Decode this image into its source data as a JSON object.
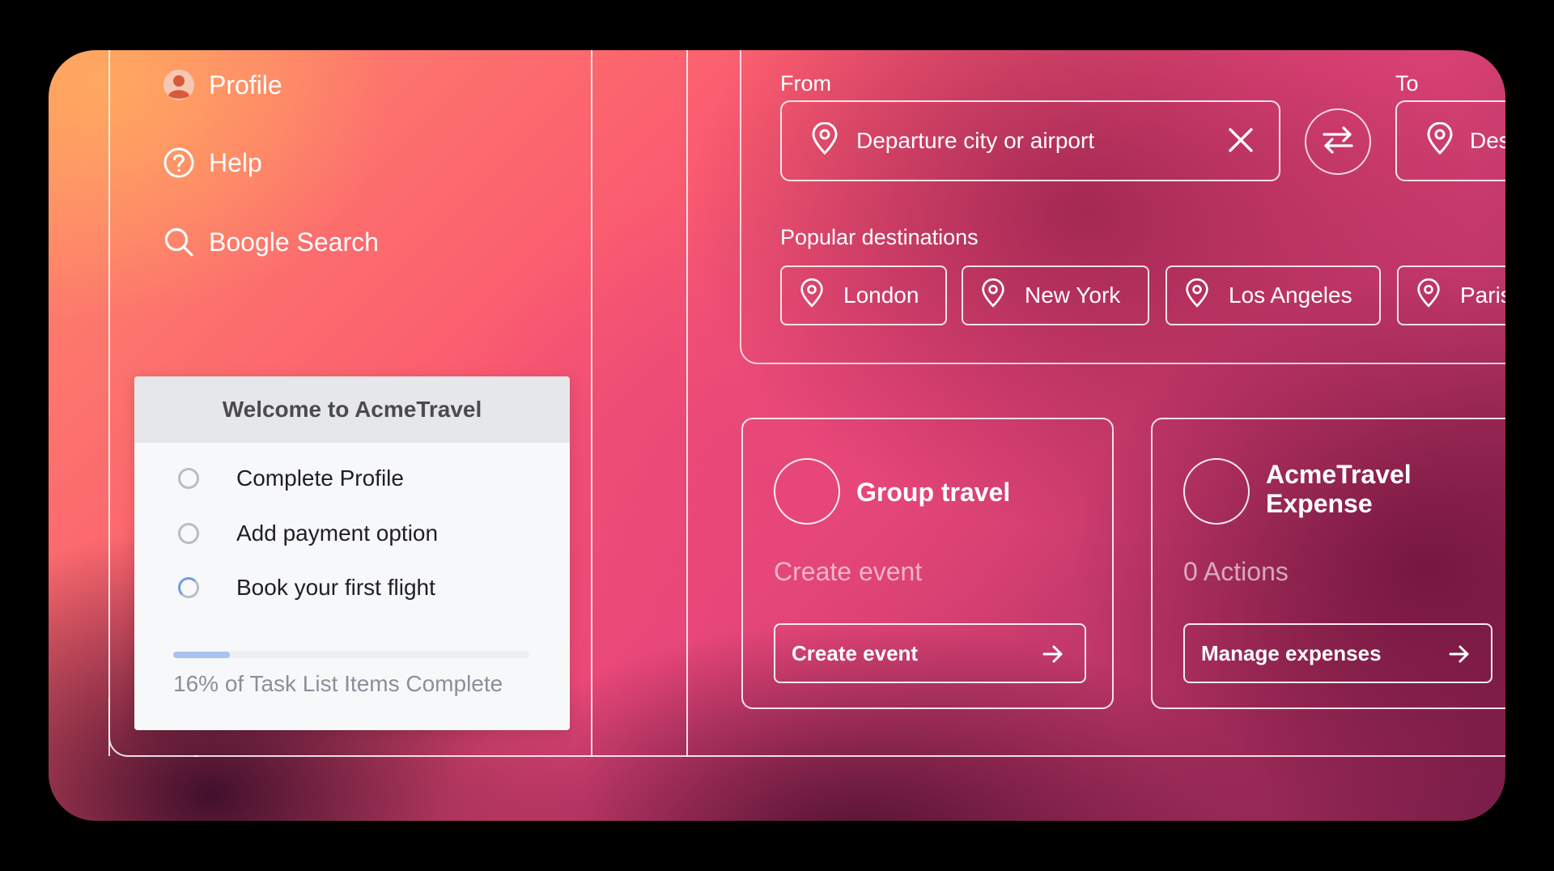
{
  "sidebar": {
    "items": [
      {
        "label": "Profile",
        "icon": "avatar-icon"
      },
      {
        "label": "Help",
        "icon": "help-icon"
      },
      {
        "label": "Boogle Search",
        "icon": "search-icon"
      }
    ]
  },
  "welcome": {
    "title": "Welcome to AcmeTravel",
    "tasks": [
      {
        "label": "Complete Profile",
        "status": "incomplete"
      },
      {
        "label": "Add payment option",
        "status": "incomplete"
      },
      {
        "label": "Book your first flight",
        "status": "in-progress"
      }
    ],
    "progress_fraction": 0.16,
    "progress_text": "16% of Task List Items Complete"
  },
  "flight_search": {
    "from_label": "From",
    "from_placeholder": "Departure city or airport",
    "to_label": "To",
    "to_placeholder": "Destination city or airport",
    "popular_label": "Popular destinations",
    "destinations": [
      "London",
      "New York",
      "Los Angeles",
      "Paris"
    ]
  },
  "cards": {
    "group": {
      "title": "Group travel",
      "subtitle": "Create event",
      "button": "Create event"
    },
    "expense": {
      "title_line1": "AcmeTravel",
      "title_line2": "Expense",
      "subtitle": "0 Actions",
      "button": "Manage expenses"
    }
  },
  "colors": {
    "card_bg": "#f7f8fa",
    "card_header_bg": "#e6e7eb",
    "progress_fill": "#a9c2f0",
    "avatar": "#e46a4a"
  }
}
